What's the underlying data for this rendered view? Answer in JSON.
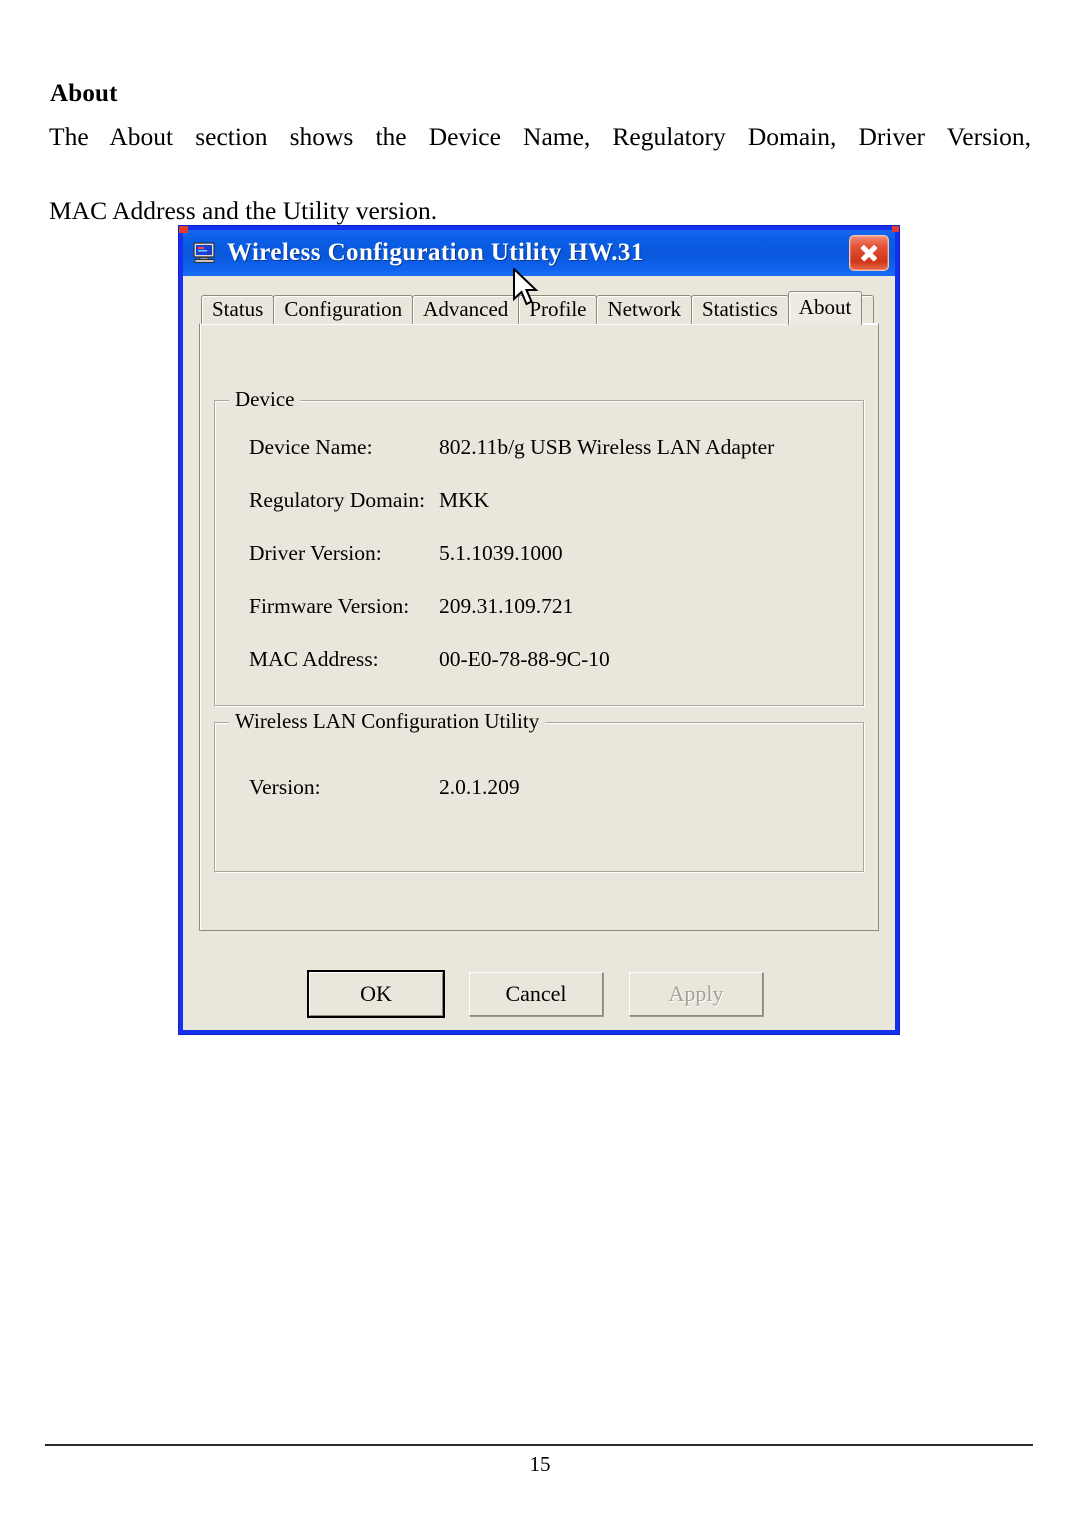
{
  "document": {
    "heading": "About",
    "paragraph_line1": "The About section shows the Device Name, Regulatory Domain, Driver Version,",
    "paragraph_line2": "MAC Address and the Utility version.",
    "page_number": "15"
  },
  "dialog": {
    "title": "Wireless Configuration Utility HW.31",
    "title_icon": "computer-monitor-icon",
    "close_icon": "close-icon",
    "colors": {
      "titlebar_blue": "#0A5FE8",
      "window_frame": "#1531EE",
      "client_background": "#E9E7DB",
      "close_button_red": "#CF3617"
    },
    "tabs": [
      {
        "label": "Status",
        "active": false
      },
      {
        "label": "Configuration",
        "active": false
      },
      {
        "label": "Advanced",
        "active": false
      },
      {
        "label": "Profile",
        "active": false
      },
      {
        "label": "Network",
        "active": false
      },
      {
        "label": "Statistics",
        "active": false
      },
      {
        "label": "About",
        "active": true
      }
    ],
    "device_group": {
      "title": "Device",
      "rows": [
        {
          "label": "Device Name:",
          "value": "802.11b/g USB Wireless LAN Adapter"
        },
        {
          "label": "Regulatory Domain:",
          "value": "MKK"
        },
        {
          "label": "Driver Version:",
          "value": "5.1.1039.1000"
        },
        {
          "label": "Firmware Version:",
          "value": "209.31.109.721"
        },
        {
          "label": "MAC Address:",
          "value": "00-E0-78-88-9C-10"
        }
      ]
    },
    "utility_group": {
      "title": "Wireless LAN Configuration Utility",
      "rows": [
        {
          "label": "Version:",
          "value": "2.0.1.209"
        }
      ]
    },
    "buttons": [
      {
        "label": "OK",
        "state": "default"
      },
      {
        "label": "Cancel",
        "state": "normal"
      },
      {
        "label": "Apply",
        "state": "disabled"
      }
    ]
  }
}
